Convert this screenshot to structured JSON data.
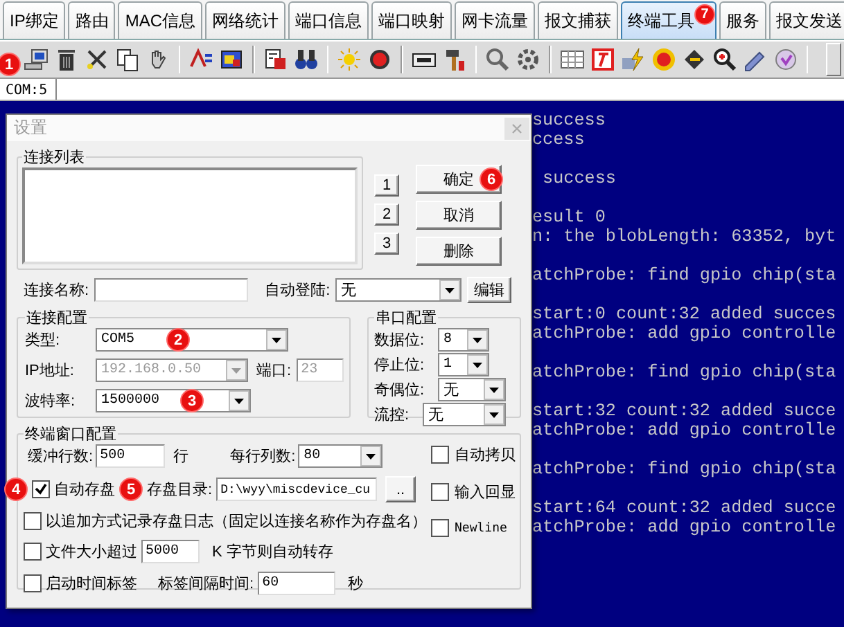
{
  "tabs": [
    {
      "label": "IP绑定",
      "selected": false
    },
    {
      "label": "路由",
      "selected": false
    },
    {
      "label": "MAC信息",
      "selected": false
    },
    {
      "label": "网络统计",
      "selected": false
    },
    {
      "label": "端口信息",
      "selected": false
    },
    {
      "label": "端口映射",
      "selected": false
    },
    {
      "label": "网卡流量",
      "selected": false
    },
    {
      "label": "报文捕获",
      "selected": false
    },
    {
      "label": "终端工具",
      "selected": true,
      "badge": "7"
    },
    {
      "label": "服务",
      "selected": false
    },
    {
      "label": "报文发送",
      "selected": false
    }
  ],
  "toolbar": {
    "badge": "1"
  },
  "session_tabs": [
    {
      "label": "COM:5",
      "selected": true
    }
  ],
  "terminal": {
    "paragraphs": [
      [
        "success",
        "ccess"
      ],
      [
        " success"
      ],
      [
        "esult 0",
        "n: the blobLength: 63352, byt"
      ],
      [
        "atchProbe: find gpio chip(sta"
      ],
      [
        "start:0 count:32 added succes",
        "atchProbe: add gpio controlle"
      ],
      [
        "atchProbe: find gpio chip(sta"
      ],
      [
        "start:32 count:32 added succe",
        "atchProbe: add gpio controlle"
      ],
      [
        "atchProbe: find gpio chip(sta"
      ],
      [
        "start:64 count:32 added succe",
        "atchProbe: add gpio controlle"
      ]
    ]
  },
  "dialog": {
    "title": "设置",
    "connection_list": {
      "label": "连接列表"
    },
    "slot_buttons": [
      "1",
      "2",
      "3"
    ],
    "buttons": [
      {
        "label": "确定",
        "badge": "6"
      },
      {
        "label": "取消"
      },
      {
        "label": "删除"
      }
    ],
    "connection_name": {
      "label": "连接名称:"
    },
    "auto_login": {
      "label": "自动登陆:",
      "value": "无"
    },
    "edit_button": "编辑",
    "connection_config": {
      "label": "连接配置",
      "type": {
        "label": "类型:",
        "value": "COM5",
        "badge": "2"
      },
      "ip": {
        "label": "IP地址:",
        "value": "192.168.0.50",
        "disabled": true
      },
      "port": {
        "label": "端口:",
        "value": "23",
        "disabled": true
      },
      "baud": {
        "label": "波特率:",
        "value": "1500000",
        "badge": "3"
      }
    },
    "serial_config": {
      "label": "串口配置",
      "fields": [
        {
          "label": "数据位:",
          "value": "8"
        },
        {
          "label": "停止位:",
          "value": "1"
        },
        {
          "label": "奇偶位:",
          "value": "无"
        },
        {
          "label": "流控:",
          "value": "无"
        }
      ]
    },
    "terminal_config": {
      "label": "终端窗口配置",
      "buffer_lines": {
        "label": "缓冲行数:",
        "value": "500",
        "unit": "行"
      },
      "columns": {
        "label": "每行列数:",
        "value": "80"
      },
      "auto_save": {
        "label": "自动存盘",
        "checked": true,
        "badge": "4"
      },
      "save_dir": {
        "label": "存盘目录:",
        "value": "D:\\wyy\\miscdevice_cu",
        "browse": "..",
        "badge": "5"
      },
      "append_log": {
        "label": "以追加方式记录存盘日志（固定以连接名称作为存盘名）",
        "checked": false
      },
      "file_size": {
        "label": "文件大小超过",
        "checked": false,
        "value": "5000",
        "unit": "K 字节则自动转存"
      },
      "timestamp": {
        "label": "启动时间标签",
        "checked": false
      },
      "interval": {
        "label": "标签间隔时间:",
        "value": "60",
        "unit": "秒"
      },
      "options": [
        {
          "label": "自动拷贝",
          "checked": false
        },
        {
          "label": "输入回显",
          "checked": false
        },
        {
          "label": "Newline",
          "checked": false
        }
      ]
    }
  }
}
